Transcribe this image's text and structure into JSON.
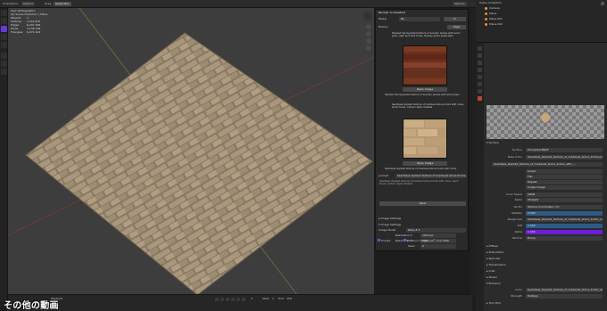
{
  "topbar": {
    "menu_1": "Orientation:",
    "menu_2": "Default",
    "menu_3": "Drag:",
    "menu_4": "Select Box",
    "options": "Options"
  },
  "viewport": {
    "view_name": "User Orthographic",
    "collection": "(0) Scene Collection | Plane",
    "stats": [
      {
        "label": "Objects",
        "value": "1"
      },
      {
        "label": "Vertices",
        "value": "3,161,870"
      },
      {
        "label": "Edges",
        "value": "6,297,305"
      },
      {
        "label": "Faces",
        "value": "3,135,736"
      },
      {
        "label": "Triangles",
        "value": "6,272,424"
      }
    ]
  },
  "overlay": {
    "title": "Blender AI Assistant",
    "model_label": "Model",
    "model_value": "Ba",
    "history_label": "History",
    "clear_label": "Clear",
    "prompt_1": "Stylized hand-painted texture of wooden planks with wood grain, light and dark tones, fantasy game asset style",
    "open_image_1": "Open Image",
    "caption_1": "Stylized hand-painted texture of wooden planks with wood grain",
    "prompt_2": "Seamless stylized texture of medieval stone bricks with moss, warm tones, cartoon style, tileable",
    "open_image_2": "Open Image",
    "caption_2": "Seamless stylized texture of medieval stone bricks with moss",
    "prompt_label": "prompt",
    "prompt_value": "Seamless stylized texture of medieval stone bricks, tileable",
    "send_label": "Send",
    "image_settings_label": "Image Settings",
    "image_model_label": "Image Model",
    "image_model_value": "DALL-E 3",
    "resolution_x_label": "Resolution X",
    "resolution_x_value": "1024 px",
    "resolution_y_label": "Resolution Y",
    "resolution_y_value": "1024 px",
    "seed_label": "Seed",
    "seed_value": "0",
    "checkbox_1": "Private",
    "checkbox_2": "Enhance Image",
    "checkbox_3": "Use HDRI"
  },
  "outliner": {
    "title": "Scene Collection",
    "items": [
      "Camera",
      "Plane",
      "Plane.001",
      "Plane.002"
    ]
  },
  "properties": {
    "surface_section": "Surface",
    "surface_label": "Surface",
    "surface_value": "Principled BSDF",
    "base_color_label": "Base Color",
    "base_color_value": "Seamless_stylized_texture_of_medieval_stone_bricks.png",
    "image_row_value": "Seamless_stylized_texture_of_medieval_stone_bricks_with_...",
    "linear_label": "Linear",
    "flat_label": "Flat",
    "repeat_label": "Repeat",
    "single_image_label": "Single Image",
    "color_space_label": "Color Space",
    "color_space_value": "sRGB",
    "alpha_label": "Alpha",
    "alpha_value": "Straight",
    "vector_label": "Vector",
    "vector_value": "Texture Coordinate | UV",
    "metallic_label": "Metallic",
    "metallic_value": "0.000",
    "roughness_label": "Roughness",
    "roughness_value": "Seamless_stylized_texture_of_medieval_stone_bricks_rough.png",
    "ior_label": "IOR",
    "ior_value": "1.500",
    "alpha2_label": "Alpha",
    "alpha2_value": "1.000",
    "normal_label": "Normal",
    "normal_value": "Bump",
    "sections": [
      "Diffuse",
      "Subsurface",
      "Specular",
      "Transmission",
      "Coat",
      "Sheen",
      "Emission",
      "Thin Film"
    ],
    "color_label": "Color",
    "color_value": "Seamless_stylized_texture_of_medieval_stone_bricks_with_moss.png",
    "strength_label": "Strength",
    "strength_value": "Multiply"
  },
  "timeline": {
    "playback": "Playback",
    "frame": "1",
    "start": "Start",
    "start_value": "1",
    "end": "End",
    "end_value": "250"
  },
  "caption": "その他の動画"
}
